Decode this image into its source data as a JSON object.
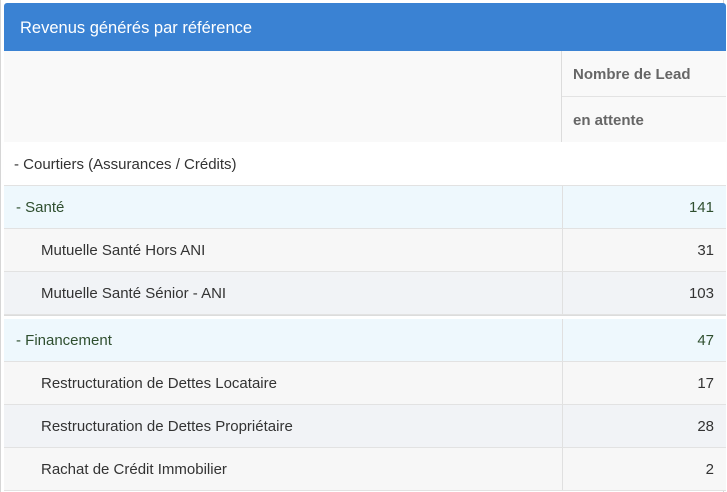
{
  "panel": {
    "title": "Revenus générés par référence"
  },
  "table": {
    "header": {
      "col_line1": "Nombre de Lead",
      "col_line2": "en attente"
    },
    "top_row": "- Courtiers (Assurances / Crédits)",
    "groups": [
      {
        "label": "- Santé",
        "value": "141",
        "items": [
          {
            "label": "Mutuelle Santé Hors ANI",
            "value": "31"
          },
          {
            "label": "Mutuelle Santé Sénior - ANI",
            "value": "103"
          }
        ]
      },
      {
        "label": "- Financement",
        "value": "47",
        "items": [
          {
            "label": "Restructuration de Dettes Locataire",
            "value": "17"
          },
          {
            "label": "Restructuration de Dettes Propriétaire",
            "value": "28"
          },
          {
            "label": "Rachat de Crédit Immobilier",
            "value": "2"
          }
        ]
      }
    ]
  }
}
